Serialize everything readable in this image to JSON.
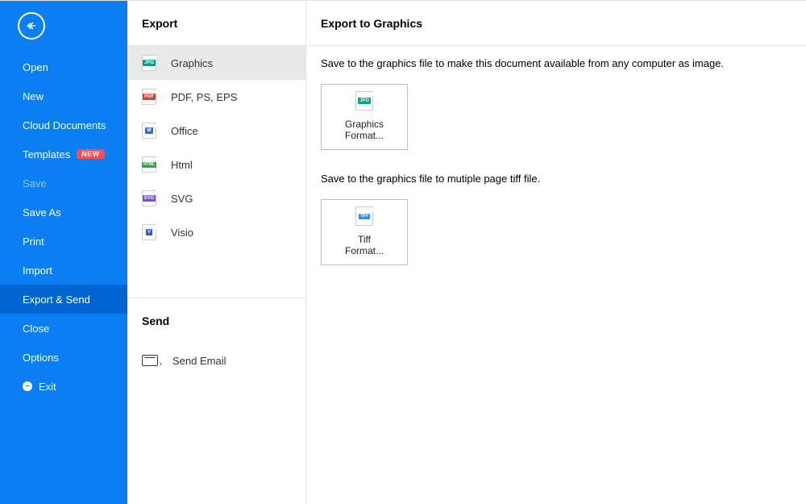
{
  "sidebar": {
    "items": [
      {
        "label": "Open"
      },
      {
        "label": "New"
      },
      {
        "label": "Cloud Documents"
      },
      {
        "label": "Templates",
        "badge": "NEW"
      },
      {
        "label": "Save"
      },
      {
        "label": "Save As"
      },
      {
        "label": "Print"
      },
      {
        "label": "Import"
      },
      {
        "label": "Export & Send"
      },
      {
        "label": "Close"
      },
      {
        "label": "Options"
      },
      {
        "label": "Exit"
      }
    ]
  },
  "mid": {
    "export_header": "Export",
    "export_items": [
      {
        "label": "Graphics",
        "icon": "jpg"
      },
      {
        "label": "PDF, PS, EPS",
        "icon": "pdf"
      },
      {
        "label": "Office",
        "icon": "w"
      },
      {
        "label": "Html",
        "icon": "html"
      },
      {
        "label": "SVG",
        "icon": "svg"
      },
      {
        "label": "Visio",
        "icon": "v"
      }
    ],
    "send_header": "Send",
    "send_items": [
      {
        "label": "Send Email"
      }
    ]
  },
  "content": {
    "header": "Export to Graphics",
    "desc1": "Save to the graphics file to make this document available from any computer as image.",
    "card1_line1": "Graphics",
    "card1_line2": "Format...",
    "desc2": "Save to the graphics file to mutiple page tiff file.",
    "card2_line1": "Tiff",
    "card2_line2": "Format..."
  },
  "icon_tags": {
    "jpg": "JPG",
    "pdf": "PDF",
    "w": "W",
    "html": "HTML",
    "svg": "SVG",
    "v": "V",
    "tiff": "TIFF"
  }
}
